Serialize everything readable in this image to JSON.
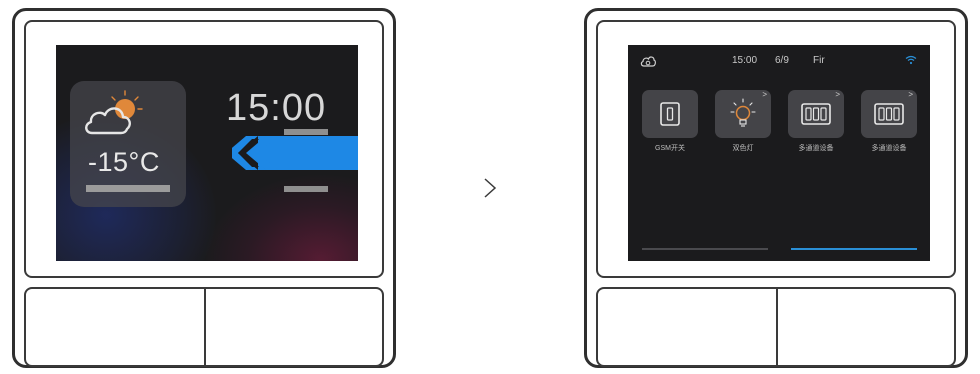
{
  "home_screen": {
    "temperature": "-15°C",
    "clock": "15:00",
    "weather_icon": "cloud-sun-icon",
    "swipe_icon": "double-chevron-left-icon"
  },
  "navigation": {
    "arrow_icon": "chevron-right-icon",
    "arrow_glyph": ">"
  },
  "device_screen": {
    "status_bar": {
      "cloud_icon": "cloud-icon",
      "time": "15:00",
      "date": "6/9",
      "day": "Fir",
      "wifi_icon": "wifi-icon"
    },
    "devices": [
      {
        "label": "GSM开关",
        "icon": "switch-icon",
        "chevron": ""
      },
      {
        "label": "双色灯",
        "icon": "bulb-icon",
        "chevron": ">"
      },
      {
        "label": "多通道设备",
        "icon": "multi-switch-icon",
        "chevron": ">"
      },
      {
        "label": "多通道设备",
        "icon": "multi-switch-icon",
        "chevron": ">"
      }
    ],
    "page_indicator": {
      "pages": 2,
      "active_page": 2
    }
  },
  "colors": {
    "accent_blue": "#1e88e5",
    "wifi_blue": "#2a8fd6",
    "sun_orange": "#e0883a",
    "screen_bg": "#1b1b1d",
    "tile_bg": "#444448"
  }
}
